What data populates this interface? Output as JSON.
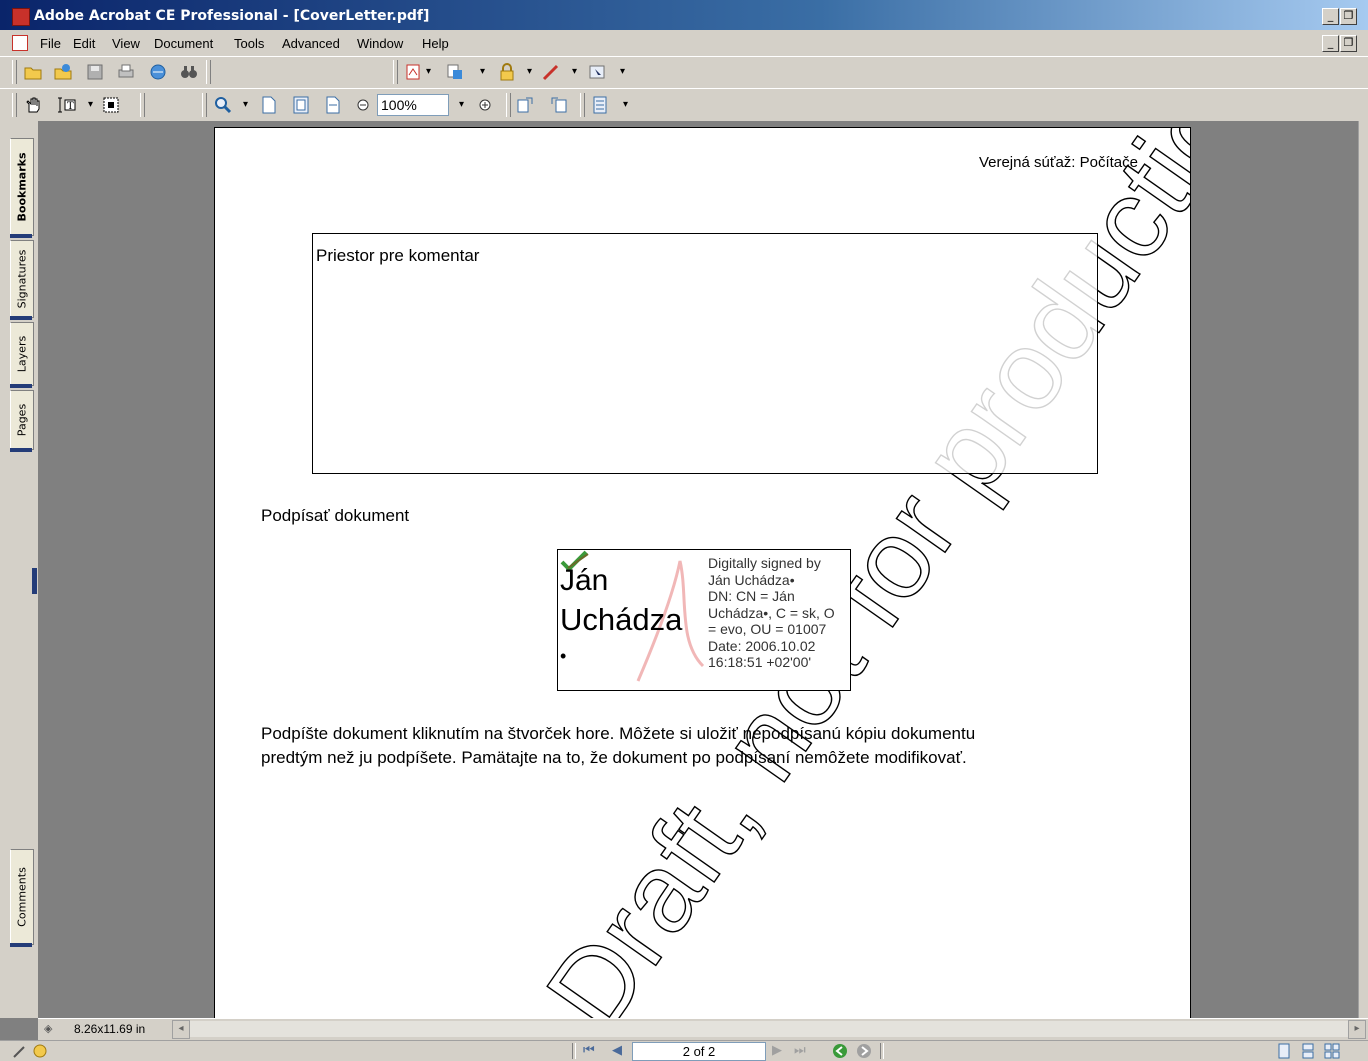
{
  "window": {
    "title": "Adobe Acrobat CE Professional - [CoverLetter.pdf]"
  },
  "menu": [
    "File",
    "Edit",
    "View",
    "Document",
    "Tools",
    "Advanced",
    "Window",
    "Help"
  ],
  "toolbar": {
    "zoom_value": "100%",
    "icons_row1": [
      "open-icon",
      "organize-icon",
      "save-icon",
      "print-icon",
      "email-icon",
      "search-icon",
      "create-pdf-icon",
      "export-icon",
      "secure-icon",
      "sign-icon",
      "review-icon"
    ],
    "icons_row2": [
      "hand-tool-icon",
      "select-text-icon",
      "snapshot-icon",
      "zoom-icon",
      "actual-size-icon",
      "fit-page-icon",
      "fit-width-icon",
      "zoom-out-icon",
      "zoom-in-icon",
      "rotate-ccw-icon",
      "rotate-cw-icon",
      "page-layout-icon"
    ]
  },
  "sidebar": {
    "tabs": [
      "Bookmarks",
      "Signatures",
      "Layers",
      "Pages",
      "Comments"
    ]
  },
  "document": {
    "header": "Verejná súťaž: Počítače",
    "comment_box": "Priestor pre komentar",
    "sign_heading": "Podpísať dokument",
    "signature": {
      "name_line1": "Ján",
      "name_line2": "Uchádza",
      "bullet": "•",
      "details": [
        "Digitally signed by",
        "Ján Uchádza•",
        "DN: CN = Ján",
        "Uchádza•, C = sk, O",
        "= evo, OU = 01007",
        "Date: 2006.10.02",
        "16:18:51 +02'00'"
      ]
    },
    "instructions_line1": "Podpíšte dokument kliknutím na štvorček hore. Môžete si uložiť nepodpísanú kópiu dokumentu",
    "instructions_line2": "predtým než ju podpíšete. Pamätajte na to, že dokument po podpísaní nemôžete modifikovať.",
    "watermark": "Draft, not for production use"
  },
  "status": {
    "page_size": "8.26x11.69 in",
    "page_indicator": "2 of 2"
  },
  "colors": {
    "title_bar": "#0a246a",
    "chrome": "#d4d0c8",
    "doc_background": "#808080"
  }
}
